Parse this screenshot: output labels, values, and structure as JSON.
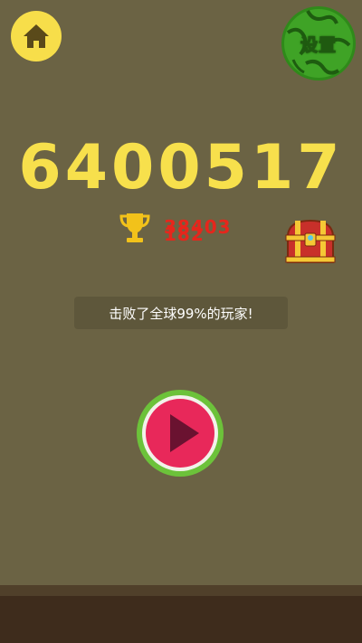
{
  "game": {
    "score": "6400517",
    "best_score": "38403",
    "best_score_overlay": "182",
    "rank_message": "击败了全球99%的玩家!"
  },
  "buttons": {
    "home_icon": "home-icon",
    "settings_label": "设置",
    "play_icon": "play-icon",
    "treasure_icon": "treasure-chest-icon"
  },
  "colors": {
    "background": "#6b6344",
    "score": "#f7e04c",
    "best_score": "#e6261c",
    "home_button": "#f7de4a",
    "play_button": "#e8285a",
    "settings_button": "#3f9a1f",
    "ground": "#3e2c1c"
  }
}
